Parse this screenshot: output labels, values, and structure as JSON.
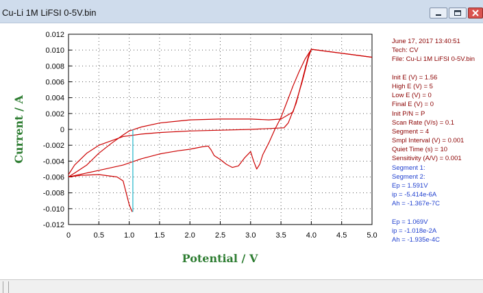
{
  "window": {
    "title": "Cu-Li 1M LiFSI 0-5V.bin"
  },
  "colors": {
    "axis_label": "#2e7d32",
    "curve": "#cc0000",
    "vertical_marker": "#20b5c8",
    "info_header": "#8b0000",
    "info_results": "#1f3fcf"
  },
  "info_panel": {
    "header_lines": [
      "June 17, 2017   13:40:51",
      "Tech: CV",
      "File: Cu-Li 1M LiFSI 0-5V.bin",
      "",
      "Init E (V) = 1.56",
      "High E (V) = 5",
      "Low E (V) = 0",
      "Final E (V) = 0",
      "Init P/N = P",
      "Scan Rate (V/s) = 0.1",
      "Segment = 4",
      "Smpl Interval (V) = 0.001",
      "Quiet Time (s) = 10",
      "Sensitivity (A/V) = 0.001"
    ],
    "result_lines": [
      "Segment 1:",
      "Segment 2:",
      "Ep = 1.591V",
      "ip = -5.414e-6A",
      "Ah = -1.367e-7C",
      "",
      "Ep = 1.069V",
      "ip = -1.018e-2A",
      "Ah = -1.935e-4C"
    ]
  },
  "chart_data": {
    "type": "line",
    "xlabel": "Potential / V",
    "ylabel": "Current / A",
    "xlim": [
      0,
      5.0
    ],
    "ylim": [
      -0.012,
      0.012
    ],
    "x_ticks": [
      "0",
      "0.5",
      "1.0",
      "1.5",
      "2.0",
      "2.5",
      "3.0",
      "3.5",
      "4.0",
      "4.5",
      "5.0"
    ],
    "y_ticks": [
      "0.012",
      "0.010",
      "0.008",
      "0.006",
      "0.004",
      "0.002",
      "0",
      "-0.002",
      "-0.004",
      "-0.006",
      "-0.008",
      "-0.010",
      "-0.012"
    ],
    "grid": true,
    "series": [
      {
        "x": [
          0.0,
          0.1,
          0.3,
          0.5,
          0.7,
          0.9,
          1.0,
          1.2,
          1.5,
          2.0,
          2.5,
          3.0,
          3.3,
          3.5,
          3.7,
          3.85,
          3.95,
          4.0,
          4.5,
          5.0
        ],
        "y": [
          -0.006,
          -0.0055,
          -0.0045,
          -0.003,
          -0.0018,
          -0.0007,
          -0.0002,
          0.0003,
          0.0008,
          0.0012,
          0.0013,
          0.0013,
          0.0012,
          0.0013,
          0.0022,
          0.006,
          0.009,
          0.0101,
          0.0096,
          0.0091
        ]
      },
      {
        "x": [
          5.0,
          4.0,
          3.95,
          3.85,
          3.75,
          3.62,
          3.55,
          3.3,
          3.0,
          2.5,
          2.0,
          1.5,
          1.2,
          1.0,
          0.9,
          0.5,
          0.3,
          0.1,
          0.0
        ],
        "y": [
          0.0091,
          0.0101,
          0.0092,
          0.0062,
          0.0033,
          0.0008,
          0.0002,
          0.0001,
          0.0,
          -0.0001,
          -0.0002,
          -0.0004,
          -0.0006,
          -0.0008,
          -0.0009,
          -0.002,
          -0.003,
          -0.0045,
          -0.0057
        ]
      },
      {
        "x": [
          0.0,
          0.2,
          0.5,
          0.8,
          0.9,
          1.0,
          1.05
        ],
        "y": [
          -0.006,
          -0.0058,
          -0.0057,
          -0.006,
          -0.0065,
          -0.0095,
          -0.0104
        ]
      },
      {
        "x": [
          0.0,
          0.3,
          0.6,
          0.9,
          1.2,
          1.5,
          1.8,
          2.0,
          2.2,
          2.3,
          2.35,
          2.4,
          2.5,
          2.6,
          2.7,
          2.8,
          2.9,
          3.0,
          3.05,
          3.1,
          3.15,
          3.2,
          3.3,
          3.4,
          3.5,
          3.6,
          3.7,
          3.8,
          3.9,
          4.0
        ],
        "y": [
          -0.006,
          -0.0055,
          -0.005,
          -0.0045,
          -0.0037,
          -0.0031,
          -0.0027,
          -0.0025,
          -0.0022,
          -0.0021,
          -0.0026,
          -0.0033,
          -0.0038,
          -0.0044,
          -0.0048,
          -0.0046,
          -0.0036,
          -0.0028,
          -0.004,
          -0.005,
          -0.0044,
          -0.0032,
          -0.0017,
          0.0,
          0.0015,
          0.0035,
          0.0055,
          0.0073,
          0.0089,
          0.0101
        ]
      }
    ],
    "markers": [
      {
        "x": 1.06,
        "y_from": 0.0,
        "y_to": -0.0104
      }
    ]
  }
}
